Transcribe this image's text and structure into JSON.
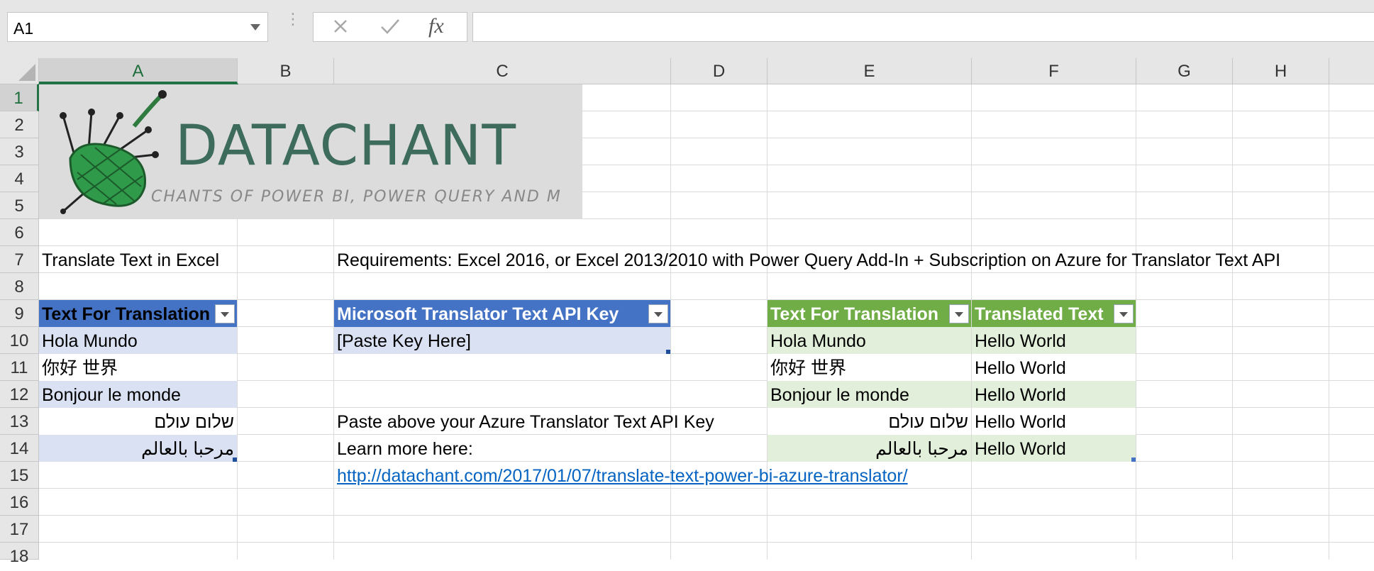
{
  "formula_bar": {
    "name_box": "A1",
    "fx": "fx",
    "formula": ""
  },
  "columns": [
    "A",
    "B",
    "C",
    "D",
    "E",
    "F",
    "G",
    "H"
  ],
  "rows": [
    "1",
    "2",
    "3",
    "4",
    "5",
    "6",
    "7",
    "8",
    "9",
    "10",
    "11",
    "12",
    "13",
    "14",
    "15",
    "16",
    "17",
    "18"
  ],
  "logo": {
    "title": "DATACHANT",
    "tagline": "CHANTS OF POWER BI, POWER QUERY AND M"
  },
  "sheet": {
    "a7": "Translate Text in Excel",
    "c7": "Requirements: Excel 2016, or Excel 2013/2010 with Power Query Add-In + Subscription on Azure for Translator Text API",
    "source_table": {
      "header": "Text For Translation",
      "values": [
        "Hola Mundo",
        "你好 世界",
        "Bonjour le monde",
        "שלום עולם",
        "مرحبا بالعالم"
      ]
    },
    "key_table": {
      "header": "Microsoft Translator Text API Key",
      "value": "[Paste Key Here]"
    },
    "c13": "Paste above your Azure Translator Text API Key",
    "c14": "Learn more here:",
    "c15": "http://datachant.com/2017/01/07/translate-text-power-bi-azure-translator/",
    "result_table": {
      "header_source": "Text For Translation",
      "header_translated": "Translated Text",
      "source": [
        "Hola Mundo",
        "你好 世界",
        "Bonjour le monde",
        "שלום עולם",
        "مرحبا بالعالم"
      ],
      "translated": [
        "Hello World",
        "Hello World",
        "Hello World",
        "Hello World",
        "Hello World"
      ]
    }
  },
  "colors": {
    "excel_green": "#217346",
    "table_blue": "#4472c4",
    "table_blue_band": "#d9e1f2",
    "table_green": "#70ad47",
    "table_green_band": "#e2efda",
    "link": "#0563c1"
  }
}
